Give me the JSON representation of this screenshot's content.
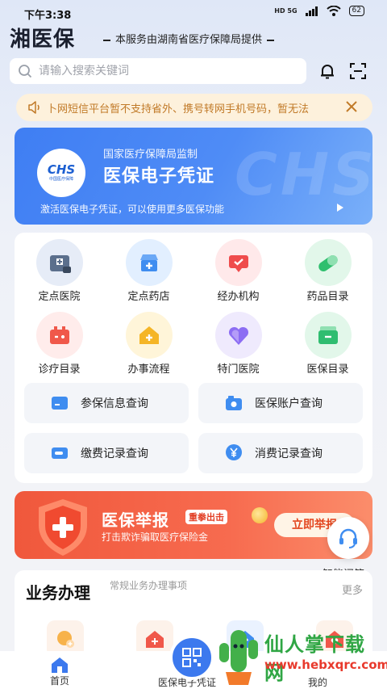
{
  "status": {
    "time": "下午3:38",
    "network": "HD 5G",
    "battery": "62"
  },
  "header": {
    "title": "湘医保",
    "subtitle": "本服务由湖南省医疗保障局提供"
  },
  "search": {
    "placeholder": "请输入搜索关键词"
  },
  "notice": {
    "text": "卜网短信平台暂不支持省外、携号转网手机号码，暂无法"
  },
  "voucher": {
    "logo_text": "CHS",
    "logo_sub": "中国医疗保障",
    "supervisor": "国家医疗保障局监制",
    "title": "医保电子凭证",
    "description": "激活医保电子凭证，可以使用更多医保功能",
    "watermark": "CHS"
  },
  "services": {
    "items": [
      {
        "label": "定点医院",
        "icon": "hospital-icon",
        "color": "#5b6f8c",
        "bg": "#e6ecf7"
      },
      {
        "label": "定点药店",
        "icon": "pharmacy-icon",
        "color": "#3f8df0",
        "bg": "#e2efff"
      },
      {
        "label": "经办机构",
        "icon": "agency-icon",
        "color": "#ef4c4c",
        "bg": "#ffe9ea"
      },
      {
        "label": "药品目录",
        "icon": "pill-icon",
        "color": "#2fbf6e",
        "bg": "#e2f7ea"
      },
      {
        "label": "诊疗目录",
        "icon": "medkit-icon",
        "color": "#f0584a",
        "bg": "#ffeceb"
      },
      {
        "label": "办事流程",
        "icon": "workflow-icon",
        "color": "#f5b526",
        "bg": "#fff5d9"
      },
      {
        "label": "特门医院",
        "icon": "heart-icon",
        "color": "#8c6df3",
        "bg": "#efeafd"
      },
      {
        "label": "医保目录",
        "icon": "wallet-icon",
        "color": "#2fbd70",
        "bg": "#e2f7ea"
      }
    ],
    "quick": [
      {
        "label": "参保信息查询",
        "icon": "card-info-icon",
        "color": "#3f8df0"
      },
      {
        "label": "医保账户查询",
        "icon": "camera-account-icon",
        "color": "#3f8df0"
      },
      {
        "label": "缴费记录查询",
        "icon": "payment-card-icon",
        "color": "#3f8df0"
      },
      {
        "label": "消费记录查询",
        "icon": "yuan-bubble-icon",
        "color": "#3f8df0"
      }
    ]
  },
  "report": {
    "title": "医保举报",
    "badge": "重拳出击",
    "description": "打击欺诈骗取医疗保险金",
    "button": "立即举报"
  },
  "assistant": {
    "label": "智能问答"
  },
  "business": {
    "title": "业务办理",
    "subtitle": "常规业务办理事项",
    "more": "更多"
  },
  "nav": {
    "home": "首页",
    "voucher": "医保电子凭证",
    "mine": "我的"
  },
  "watermark": {
    "text": "仙人掌下载网",
    "url": "www.hebxqrc.com"
  }
}
